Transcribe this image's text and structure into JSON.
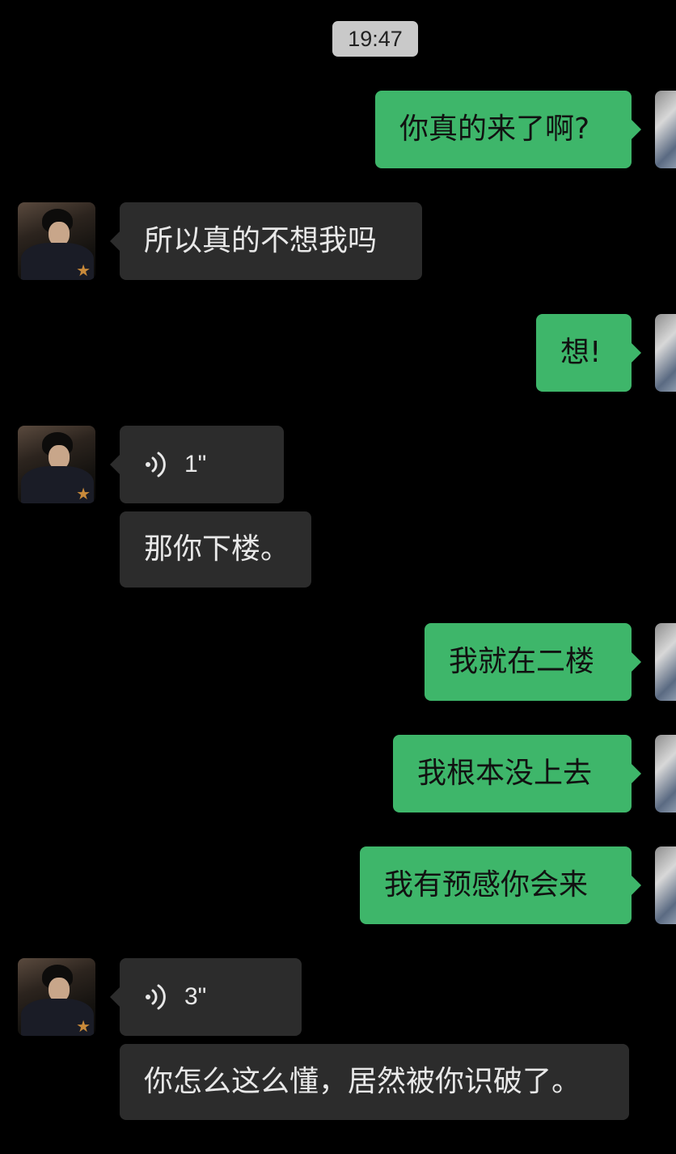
{
  "chat": {
    "timestamp": "19:47",
    "messages": [
      {
        "side": "out",
        "type": "text",
        "text": "你真的来了啊?"
      },
      {
        "side": "in",
        "type": "text",
        "text": "所以真的不想我吗"
      },
      {
        "side": "out",
        "type": "text",
        "text": "想!"
      },
      {
        "side": "in",
        "type": "voice",
        "duration": "1\""
      },
      {
        "side": "in",
        "type": "text",
        "text": "那你下楼。"
      },
      {
        "side": "out",
        "type": "text",
        "text": "我就在二楼"
      },
      {
        "side": "out",
        "type": "text",
        "text": "我根本没上去"
      },
      {
        "side": "out",
        "type": "text",
        "text": "我有预感你会来"
      },
      {
        "side": "in",
        "type": "voice",
        "duration": "3\""
      },
      {
        "side": "in",
        "type": "text",
        "text": "你怎么这么懂，居然被你识破了。"
      }
    ]
  },
  "colors": {
    "background": "#000000",
    "incoming_bubble": "#2c2c2c",
    "outgoing_bubble": "#3eb66a",
    "timestamp_bg": "#c9c9c9"
  },
  "icons": {
    "voice": "voice-wave-icon",
    "star": "star-icon"
  }
}
